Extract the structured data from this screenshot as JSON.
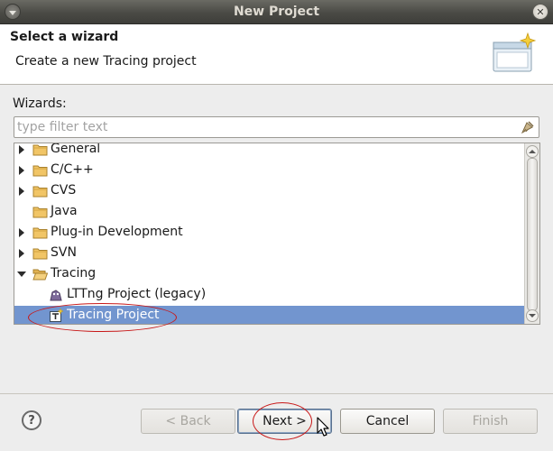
{
  "window": {
    "title": "New Project"
  },
  "header": {
    "title": "Select a wizard",
    "description": "Create a new Tracing project",
    "icon": "new-wizard-banner-icon"
  },
  "wizards_label": "Wizards:",
  "filter": {
    "placeholder": "type filter text",
    "value": ""
  },
  "tree": {
    "items": [
      {
        "label": "General",
        "state": "collapsed"
      },
      {
        "label": "C/C++",
        "state": "collapsed"
      },
      {
        "label": "CVS",
        "state": "collapsed"
      },
      {
        "label": "Java",
        "state": "none"
      },
      {
        "label": "Plug-in Development",
        "state": "collapsed"
      },
      {
        "label": "SVN",
        "state": "collapsed"
      },
      {
        "label": "Tracing",
        "state": "expanded"
      }
    ],
    "children": [
      {
        "label": "LTTng Project (legacy)",
        "icon": "lttng-project-icon"
      },
      {
        "label": "Tracing Project",
        "icon": "tracing-project-icon",
        "selected": true
      }
    ]
  },
  "buttons": {
    "back": "< Back",
    "next": "Next >",
    "cancel": "Cancel",
    "finish": "Finish",
    "help": "?"
  },
  "colors": {
    "selection": "#7295cf",
    "annotation": "#c81818",
    "titlebar": "#4a4a45"
  }
}
